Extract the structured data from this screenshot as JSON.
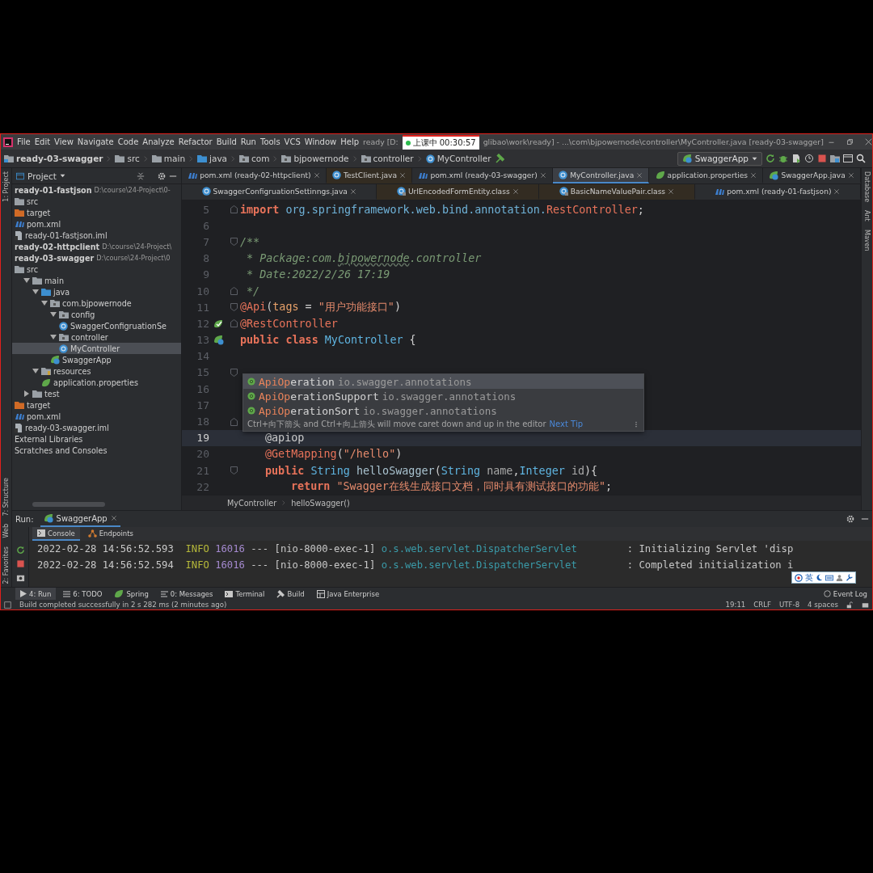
{
  "window": {
    "title_start": "ready [D:",
    "title_end": "glibao\\work\\ready] - ...\\com\\bjpowernode\\controller\\MyController.java [ready-03-swagger]"
  },
  "recorder": {
    "status": "上课中",
    "time": "00:30:57"
  },
  "menu": [
    "File",
    "Edit",
    "View",
    "Navigate",
    "Code",
    "Analyze",
    "Refactor",
    "Build",
    "Run",
    "Tools",
    "VCS",
    "Window",
    "Help"
  ],
  "breadcrumb": [
    {
      "label": "ready-03-swagger",
      "kind": "module"
    },
    {
      "label": "src",
      "kind": "folder"
    },
    {
      "label": "main",
      "kind": "folder"
    },
    {
      "label": "java",
      "kind": "source"
    },
    {
      "label": "com",
      "kind": "package"
    },
    {
      "label": "bjpowernode",
      "kind": "package"
    },
    {
      "label": "controller",
      "kind": "package"
    },
    {
      "label": "MyController",
      "kind": "class"
    }
  ],
  "run_config": "SwaggerApp",
  "left_stripe": {
    "top": [
      "1: Project"
    ],
    "bottom": [
      "7: Structure",
      "Web",
      "2: Favorites"
    ]
  },
  "right_stripe": [
    "Database",
    "Ant",
    "Maven"
  ],
  "project_panel": {
    "title": "Project",
    "tree": [
      {
        "label": "ready-01-fastjson",
        "path": "D:\\course\\24-Project\\0-",
        "kind": "module",
        "selected": false,
        "children": [
          {
            "label": "src",
            "kind": "folder",
            "selected": false
          },
          {
            "label": "target",
            "kind": "target",
            "selected": false
          },
          {
            "label": "pom.xml",
            "kind": "maven",
            "selected": false
          },
          {
            "label": "ready-01-fastjson.iml",
            "kind": "iml",
            "selected": false
          }
        ]
      },
      {
        "label": "ready-02-httpclient",
        "path": "D:\\course\\24-Project\\",
        "kind": "module",
        "selected": false
      },
      {
        "label": "ready-03-swagger",
        "path": "D:\\course\\24-Project\\0",
        "kind": "module",
        "selected": false,
        "children": [
          {
            "label": "src",
            "kind": "folder",
            "selected": false,
            "children": [
              {
                "label": "main",
                "kind": "folder",
                "expanded": true,
                "selected": false,
                "children": [
                  {
                    "label": "java",
                    "kind": "source",
                    "expanded": true,
                    "selected": false,
                    "children": [
                      {
                        "label": "com.bjpowernode",
                        "kind": "package",
                        "expanded": true,
                        "selected": false,
                        "children": [
                          {
                            "label": "config",
                            "kind": "package",
                            "expanded": true,
                            "selected": false,
                            "children": [
                              {
                                "label": "SwaggerConfigruationSe",
                                "kind": "class",
                                "selected": false
                              }
                            ]
                          },
                          {
                            "label": "controller",
                            "kind": "package",
                            "expanded": true,
                            "selected": false,
                            "children": [
                              {
                                "label": "MyController",
                                "kind": "class",
                                "selected": true
                              }
                            ]
                          },
                          {
                            "label": "SwaggerApp",
                            "kind": "spring-class",
                            "selected": false
                          }
                        ]
                      }
                    ]
                  },
                  {
                    "label": "resources",
                    "kind": "resources",
                    "expanded": true,
                    "selected": false,
                    "children": [
                      {
                        "label": "application.properties",
                        "kind": "properties",
                        "selected": false
                      }
                    ]
                  }
                ]
              },
              {
                "label": "test",
                "kind": "folder",
                "expanded": false,
                "selected": false
              }
            ]
          },
          {
            "label": "target",
            "kind": "target",
            "selected": false
          },
          {
            "label": "pom.xml",
            "kind": "maven",
            "selected": false
          },
          {
            "label": "ready-03-swagger.iml",
            "kind": "iml",
            "selected": false
          }
        ]
      },
      {
        "label": "External Libraries",
        "kind": "plain",
        "selected": false
      },
      {
        "label": "Scratches and Consoles",
        "kind": "plain",
        "selected": false
      }
    ]
  },
  "tab_rows": [
    [
      {
        "label": "pom.xml (ready-02-httpclient)",
        "kind": "maven",
        "external": false,
        "selected": false
      },
      {
        "label": "TestClient.java",
        "kind": "class",
        "external": true,
        "selected": false
      },
      {
        "label": "pom.xml (ready-03-swagger)",
        "kind": "maven",
        "external": false,
        "selected": false
      },
      {
        "label": "MyController.java",
        "kind": "class",
        "external": false,
        "selected": true
      },
      {
        "label": "application.properties",
        "kind": "properties",
        "external": false,
        "selected": false
      },
      {
        "label": "SwaggerApp.java",
        "kind": "spring-class",
        "external": false,
        "selected": false
      }
    ],
    [
      {
        "label": "SwaggerConfigruationSettinngs.java",
        "kind": "class",
        "external": false,
        "selected": false
      },
      {
        "label": "UrlEncodedFormEntity.class",
        "kind": "library-class",
        "external": true,
        "selected": false
      },
      {
        "label": "BasicNameValuePair.class",
        "kind": "library-class",
        "external": true,
        "selected": false
      },
      {
        "label": "pom.xml (ready-01-fastjson)",
        "kind": "maven",
        "external": false,
        "selected": false
      }
    ]
  ],
  "code": [
    {
      "number": "5",
      "kind": "top",
      "fold": {
        "kind": "close"
      },
      "current": false,
      "tokens": [
        {
          "text": "import",
          "kind": "kw"
        },
        {
          "text": " org.springframework.web.bind.annotation.",
          "kind": "pkg"
        },
        {
          "text": "RestController",
          "kind": "ann"
        },
        {
          "text": ";",
          "kind": "plain"
        }
      ]
    },
    {
      "number": "6",
      "kind": "top",
      "current": false
    },
    {
      "number": "7",
      "kind": "top",
      "fold": {
        "kind": "open"
      },
      "current": false,
      "tokens": [
        {
          "text": "/**",
          "kind": "comment"
        }
      ]
    },
    {
      "number": "8",
      "kind": "top",
      "current": false,
      "tokens": [
        {
          "text": " * Package:com.",
          "kind": "comment"
        },
        {
          "text": "bjpowernode",
          "kind": "typo"
        },
        {
          "text": ".controller",
          "kind": "comment"
        }
      ]
    },
    {
      "number": "9",
      "kind": "top",
      "current": false,
      "tokens": [
        {
          "text": " * Date:2022/2/26 17:19",
          "kind": "comment"
        }
      ]
    },
    {
      "number": "10",
      "kind": "top",
      "fold": {
        "kind": "close"
      },
      "current": false,
      "tokens": [
        {
          "text": " */",
          "kind": "comment"
        }
      ]
    },
    {
      "number": "11",
      "kind": "top",
      "fold": {
        "kind": "open"
      },
      "current": false,
      "tokens": [
        {
          "text": "@Api",
          "kind": "ann"
        },
        {
          "text": "(",
          "kind": "plain"
        },
        {
          "text": "tags",
          "kind": "attr"
        },
        {
          "text": " = ",
          "kind": "plain"
        },
        {
          "text": "\"用户功能接口\"",
          "kind": "str"
        },
        {
          "text": ")",
          "kind": "plain"
        }
      ]
    },
    {
      "number": "12",
      "kind": "top",
      "fold": {
        "kind": "close"
      },
      "marker": {
        "kind": "bean"
      },
      "current": false,
      "tokens": [
        {
          "text": "@RestController",
          "kind": "ann"
        }
      ]
    },
    {
      "number": "13",
      "kind": "top",
      "marker": {
        "kind": "bean-class"
      },
      "current": false,
      "tokens": [
        {
          "text": "public class ",
          "kind": "kw"
        },
        {
          "text": "MyController",
          "kind": "cls"
        },
        {
          "text": " {",
          "kind": "plain"
        }
      ]
    },
    {
      "number": "14",
      "kind": "top",
      "current": false
    },
    {
      "number": "15",
      "kind": "top",
      "fold": {
        "kind": "open"
      },
      "current": false
    },
    {
      "number": "16",
      "kind": "top",
      "current": false
    },
    {
      "number": "17",
      "kind": "top",
      "current": false
    },
    {
      "number": "18",
      "kind": "top",
      "fold": {
        "kind": "close"
      },
      "current": false
    },
    {
      "number": "19",
      "kind": "member",
      "current": true,
      "tokens": [
        {
          "text": "@apiop",
          "kind": "plain"
        }
      ]
    },
    {
      "number": "20",
      "kind": "member",
      "current": false,
      "tokens": [
        {
          "text": "@GetMapping",
          "kind": "ann"
        },
        {
          "text": "(",
          "kind": "plain"
        },
        {
          "text": "\"/hello\"",
          "kind": "str"
        },
        {
          "text": ")",
          "kind": "plain"
        }
      ]
    },
    {
      "number": "21",
      "kind": "member",
      "fold": {
        "kind": "open"
      },
      "current": false,
      "tokens": [
        {
          "text": "public ",
          "kind": "kw"
        },
        {
          "text": "String ",
          "kind": "cls"
        },
        {
          "text": "helloSwagger",
          "kind": "fn"
        },
        {
          "text": "(",
          "kind": "plain"
        },
        {
          "text": "String ",
          "kind": "cls"
        },
        {
          "text": "name",
          "kind": "param"
        },
        {
          "text": ",",
          "kind": "plain"
        },
        {
          "text": "Integer ",
          "kind": "cls"
        },
        {
          "text": "id",
          "kind": "param"
        },
        {
          "text": "){",
          "kind": "plain"
        }
      ]
    },
    {
      "number": "22",
      "kind": "body",
      "current": false,
      "tokens": [
        {
          "text": "return ",
          "kind": "kw"
        },
        {
          "text": "\"Swagger在线生成接口文档，同时具有测试接口的功能\"",
          "kind": "str"
        },
        {
          "text": ";",
          "kind": "plain"
        }
      ]
    }
  ],
  "completion": {
    "items": [
      {
        "match": "ApiOp",
        "rest": "eration",
        "package": "io.swagger.annotations",
        "selected": true
      },
      {
        "match": "ApiOp",
        "rest": "erationSupport",
        "package": "io.swagger.annotations",
        "selected": false
      },
      {
        "match": "ApiOp",
        "rest": "erationSort",
        "package": "io.swagger.annotations",
        "selected": false
      }
    ],
    "hint": "Ctrl+向下箭头 and Ctrl+向上箭头 will move caret down and up in the editor",
    "hint_link": "Next Tip"
  },
  "editor_breadcrumb": [
    "MyController",
    "helloSwagger()"
  ],
  "run_panel": {
    "label": "Run:",
    "tab": "SwaggerApp",
    "console_tabs": [
      {
        "label": "Console",
        "kind": "console",
        "selected": true
      },
      {
        "label": "Endpoints",
        "kind": "endpoints",
        "selected": false
      }
    ],
    "lines": [
      {
        "time": "2022-02-28 14:56:52.593",
        "level": "INFO",
        "pid": "16016",
        "sep": "---",
        "thread": "[nio-8000-exec-1]",
        "logger": "o.s.web.servlet.DispatcherServlet",
        "message": ": Initializing Servlet 'disp"
      },
      {
        "time": "2022-02-28 14:56:52.594",
        "level": "INFO",
        "pid": "16016",
        "sep": "---",
        "thread": "[nio-8000-exec-1]",
        "logger": "o.s.web.servlet.DispatcherServlet",
        "message": ": Completed initialization i"
      }
    ]
  },
  "ime": {
    "mode": "英"
  },
  "tool_tabs": [
    {
      "label": "4: Run",
      "kind": "run",
      "selected": true
    },
    {
      "label": "6: TODO",
      "kind": "todo",
      "selected": false
    },
    {
      "label": "Spring",
      "kind": "spring",
      "selected": false
    },
    {
      "label": "0: Messages",
      "kind": "messages",
      "selected": false
    },
    {
      "label": "Terminal",
      "kind": "terminal",
      "selected": false
    },
    {
      "label": "Build",
      "kind": "build",
      "selected": false
    },
    {
      "label": "Java Enterprise",
      "kind": "enterprise",
      "selected": false
    }
  ],
  "event_log": "Event Log",
  "status_bar": {
    "message": "Build completed successfully in 2 s 282 ms (2 minutes ago)",
    "items": [
      "19:11",
      "CRLF",
      "UTF-8",
      "4 spaces"
    ]
  }
}
